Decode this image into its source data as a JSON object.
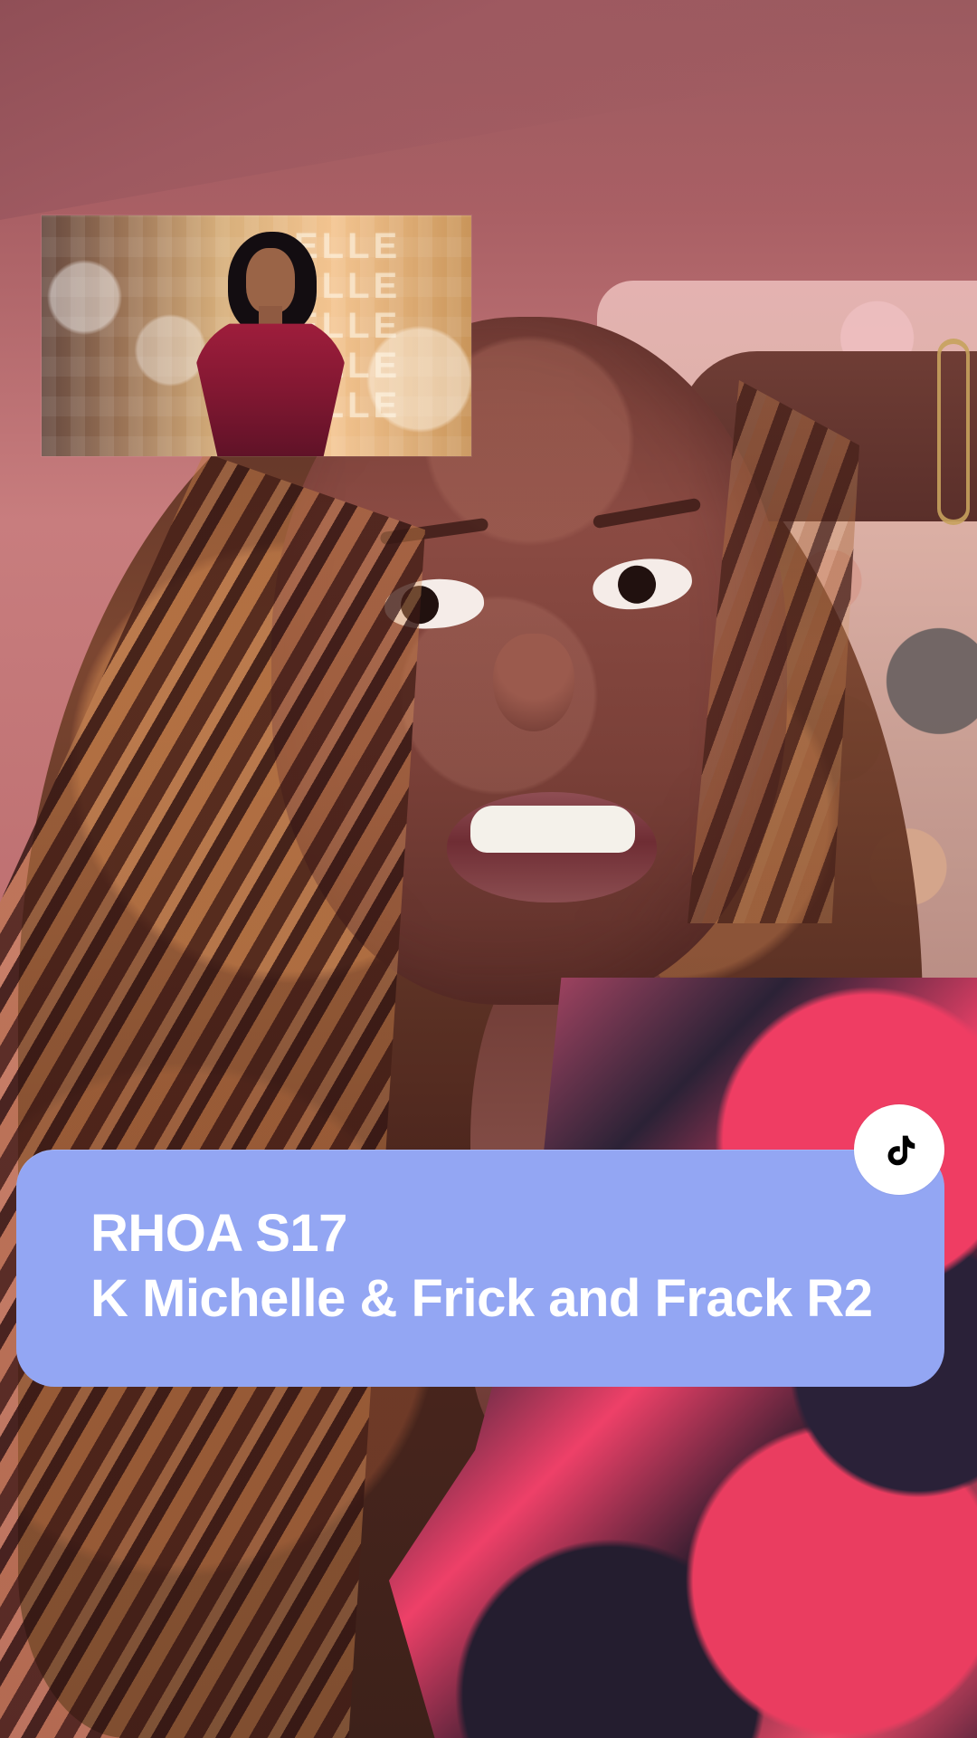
{
  "overlay": {
    "line1": "RHOA S17",
    "line2": "K Michelle & Frick and Frack R2"
  },
  "inset": {
    "repeating_text": "ELLE"
  },
  "badge": {
    "icon": "tiktok-icon"
  },
  "colors": {
    "card": "#93a6f3",
    "badge": "#ffffff",
    "text": "#ffffff"
  }
}
